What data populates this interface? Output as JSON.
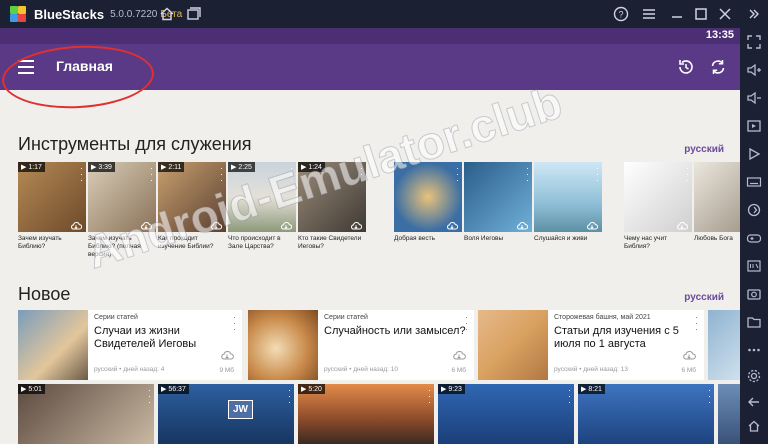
{
  "titlebar": {
    "app_name": "BlueStacks",
    "version": "5.0.0.7220",
    "beta": "Бета"
  },
  "status": {
    "time": "13:35"
  },
  "appbar": {
    "title": "Главная"
  },
  "tools": {
    "title": "Инструменты для служения",
    "lang": "русский",
    "items": [
      {
        "duration": "1:17",
        "caption": "Зачем изучать Библию?"
      },
      {
        "duration": "3:39",
        "caption": "Зачем изучать Библию? (полная версия)"
      },
      {
        "duration": "2:11",
        "caption": "Как проходит изучение Библии?"
      },
      {
        "duration": "2:25",
        "caption": "Что происходит в Зале Царства?"
      },
      {
        "duration": "1:24",
        "caption": "Кто такие Свидетели Иеговы?"
      },
      {
        "caption": "Добрая весть"
      },
      {
        "caption": "Воля Иеговы"
      },
      {
        "caption": "Слушайся и живи"
      },
      {
        "caption": "Чему нас учит Библия?"
      },
      {
        "caption": "Любовь Бога"
      }
    ]
  },
  "new": {
    "title": "Новое",
    "lang": "русский",
    "items": [
      {
        "category": "Серии статей",
        "title": "Случаи из жизни Свидетелей Иеговы",
        "meta": "русский • дней назад: 4",
        "size": "9 Мб"
      },
      {
        "category": "Серии статей",
        "title": "Случайность или замысел?",
        "meta": "русский • дней назад: 10",
        "size": "6 Мб"
      },
      {
        "category": "Сторожевая башня, май 2021",
        "title": "Статьи для изучения с 5 июля по 1 августа",
        "meta": "русский • дней назад: 13",
        "size": "6 Мб"
      }
    ]
  },
  "videos": {
    "durations": [
      "5:01",
      "56:37",
      "5:20",
      "9:23",
      "8:21"
    ],
    "jw_logo": "JW"
  },
  "watermark": "Android-Emulator.club"
}
